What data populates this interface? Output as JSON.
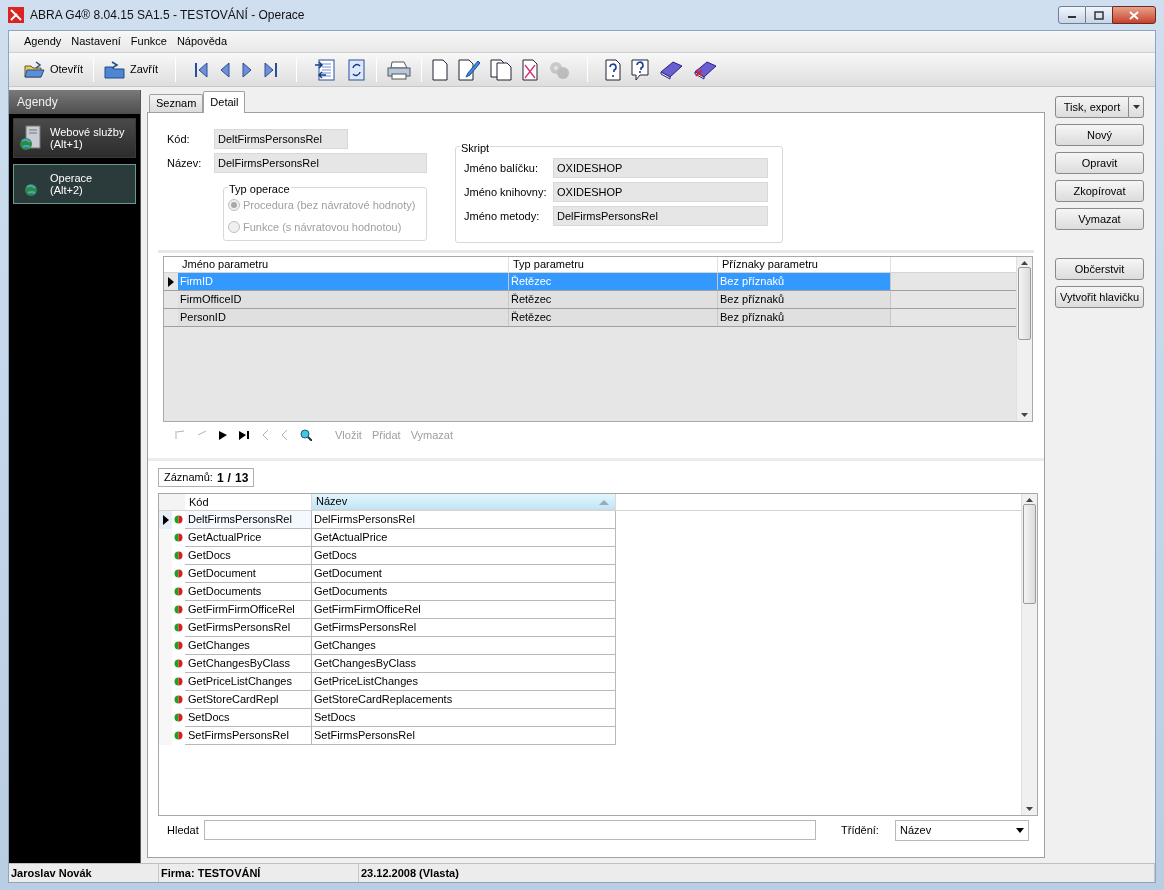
{
  "window": {
    "title": "ABRA G4® 8.04.15 SA1.5 - TESTOVÁNÍ - Operace"
  },
  "menu": [
    "Agendy",
    "Nastavení",
    "Funkce",
    "Nápověda"
  ],
  "toolbar": [
    {
      "kind": "open",
      "label": "Otevřít",
      "disabled": false
    },
    {
      "kind": "close",
      "label": "Zavřít",
      "disabled": false
    },
    {
      "kind": "first",
      "disabled": false
    },
    {
      "kind": "prev",
      "disabled": false
    },
    {
      "kind": "next",
      "disabled": false
    },
    {
      "kind": "last",
      "disabled": false
    },
    {
      "kind": "import",
      "disabled": false
    },
    {
      "kind": "refresh-doc",
      "disabled": false
    },
    {
      "kind": "print",
      "disabled": false
    },
    {
      "kind": "new",
      "disabled": false
    },
    {
      "kind": "edit",
      "disabled": false
    },
    {
      "kind": "copy",
      "disabled": false
    },
    {
      "kind": "delete",
      "disabled": false
    },
    {
      "kind": "tools",
      "disabled": true
    },
    {
      "kind": "help",
      "disabled": false
    },
    {
      "kind": "context-help",
      "disabled": false
    },
    {
      "kind": "book",
      "disabled": false
    },
    {
      "kind": "book-x",
      "disabled": false
    }
  ],
  "sidebar": {
    "title": "Agendy",
    "items": [
      {
        "label": "Webové služby",
        "shortcut": "(Alt+1)",
        "selected": false
      },
      {
        "label": "Operace",
        "shortcut": "(Alt+2)",
        "selected": true
      }
    ]
  },
  "tabs": [
    {
      "label": "Seznam",
      "selected": false
    },
    {
      "label": "Detail",
      "selected": true
    }
  ],
  "detail": {
    "code": {
      "label": "Kód:",
      "value": "DeltFirmsPersonsRel"
    },
    "name": {
      "label": "Název:",
      "value": "DelFirmsPersonsRel"
    },
    "operation_type": {
      "title": "Typ operace",
      "options": [
        {
          "label": "Procedura (bez návratové hodnoty)",
          "selected": true,
          "disabled": true
        },
        {
          "label": "Funkce (s návratovou hodnotou)",
          "selected": false,
          "disabled": true
        }
      ]
    },
    "script": {
      "title": "Skript",
      "fields": [
        {
          "label": "Jméno balíčku:",
          "value": "OXIDESHOP"
        },
        {
          "label": "Jméno knihovny:",
          "value": "OXIDESHOP"
        },
        {
          "label": "Jméno metody:",
          "value": "DelFirmsPersonsRel"
        }
      ]
    }
  },
  "parameters": {
    "columns": [
      "Jméno parametru",
      "Typ parametru",
      "Příznaky parametru"
    ],
    "rows": [
      {
        "cells": [
          "FirmID",
          "Řetězec",
          "Bez příznaků"
        ],
        "selected": true
      },
      {
        "cells": [
          "FirmOfficeID",
          "Řetězec",
          "Bez příznaků"
        ],
        "selected": false
      },
      {
        "cells": [
          "PersonID",
          "Řetězec",
          "Bez příznaků"
        ],
        "selected": false
      }
    ]
  },
  "parameter_nav": [
    {
      "kind": "first",
      "disabled": true
    },
    {
      "kind": "prev",
      "disabled": true
    },
    {
      "kind": "next",
      "disabled": false
    },
    {
      "kind": "last",
      "disabled": false
    },
    {
      "kind": "undo",
      "disabled": true
    },
    {
      "kind": "back",
      "disabled": true
    },
    {
      "kind": "search",
      "disabled": false
    },
    {
      "kind": "text",
      "label": "Vložit",
      "disabled": true
    },
    {
      "kind": "text",
      "label": "Přidat",
      "disabled": true
    },
    {
      "kind": "text",
      "label": "Vymazat",
      "disabled": true
    }
  ],
  "records": {
    "label": "Záznamů:",
    "current": "1",
    "separator": "/",
    "total": "13"
  },
  "list": {
    "columns": [
      {
        "label": "Kód",
        "sorted": false
      },
      {
        "label": "Název",
        "sorted": true
      }
    ],
    "rows": [
      {
        "code": "DeltFirmsPersonsRel",
        "name": "DelFirmsPersonsRel",
        "selected": true
      },
      {
        "code": "GetActualPrice",
        "name": "GetActualPrice",
        "selected": false
      },
      {
        "code": "GetDocs",
        "name": "GetDocs",
        "selected": false
      },
      {
        "code": "GetDocument",
        "name": "GetDocument",
        "selected": false
      },
      {
        "code": "GetDocuments",
        "name": "GetDocuments",
        "selected": false
      },
      {
        "code": "GetFirmFirmOfficeRel",
        "name": "GetFirmFirmOfficeRel",
        "selected": false
      },
      {
        "code": "GetFirmsPersonsRel",
        "name": "GetFirmsPersonsRel",
        "selected": false
      },
      {
        "code": "GetChanges",
        "name": "GetChanges",
        "selected": false
      },
      {
        "code": "GetChangesByClass",
        "name": "GetChangesByClass",
        "selected": false
      },
      {
        "code": "GetPriceListChanges",
        "name": "GetPriceListChanges",
        "selected": false
      },
      {
        "code": "GetStoreCardRepl",
        "name": "GetStoreCardReplacements",
        "selected": false
      },
      {
        "code": "SetDocs",
        "name": "SetDocs",
        "selected": false
      },
      {
        "code": "SetFirmsPersonsRel",
        "name": "SetFirmsPersonsRel",
        "selected": false
      }
    ]
  },
  "search": {
    "label": "Hledat"
  },
  "sort": {
    "label": "Třídění:",
    "value": "Název"
  },
  "actions": [
    {
      "label": "Tisk, export",
      "kind": "split"
    },
    {
      "label": "Nový",
      "kind": "button"
    },
    {
      "label": "Opravit",
      "kind": "button"
    },
    {
      "label": "Zkopírovat",
      "kind": "button"
    },
    {
      "label": "Vymazat",
      "kind": "button"
    },
    {
      "kind": "gap"
    },
    {
      "label": "Občerstvit",
      "kind": "button"
    },
    {
      "label": "Vytvořit hlavičku",
      "kind": "button"
    }
  ],
  "status_bar": [
    "Jaroslav Novák",
    "Firma: TESTOVÁNÍ",
    "23.12.2008 (Vlasta)"
  ]
}
